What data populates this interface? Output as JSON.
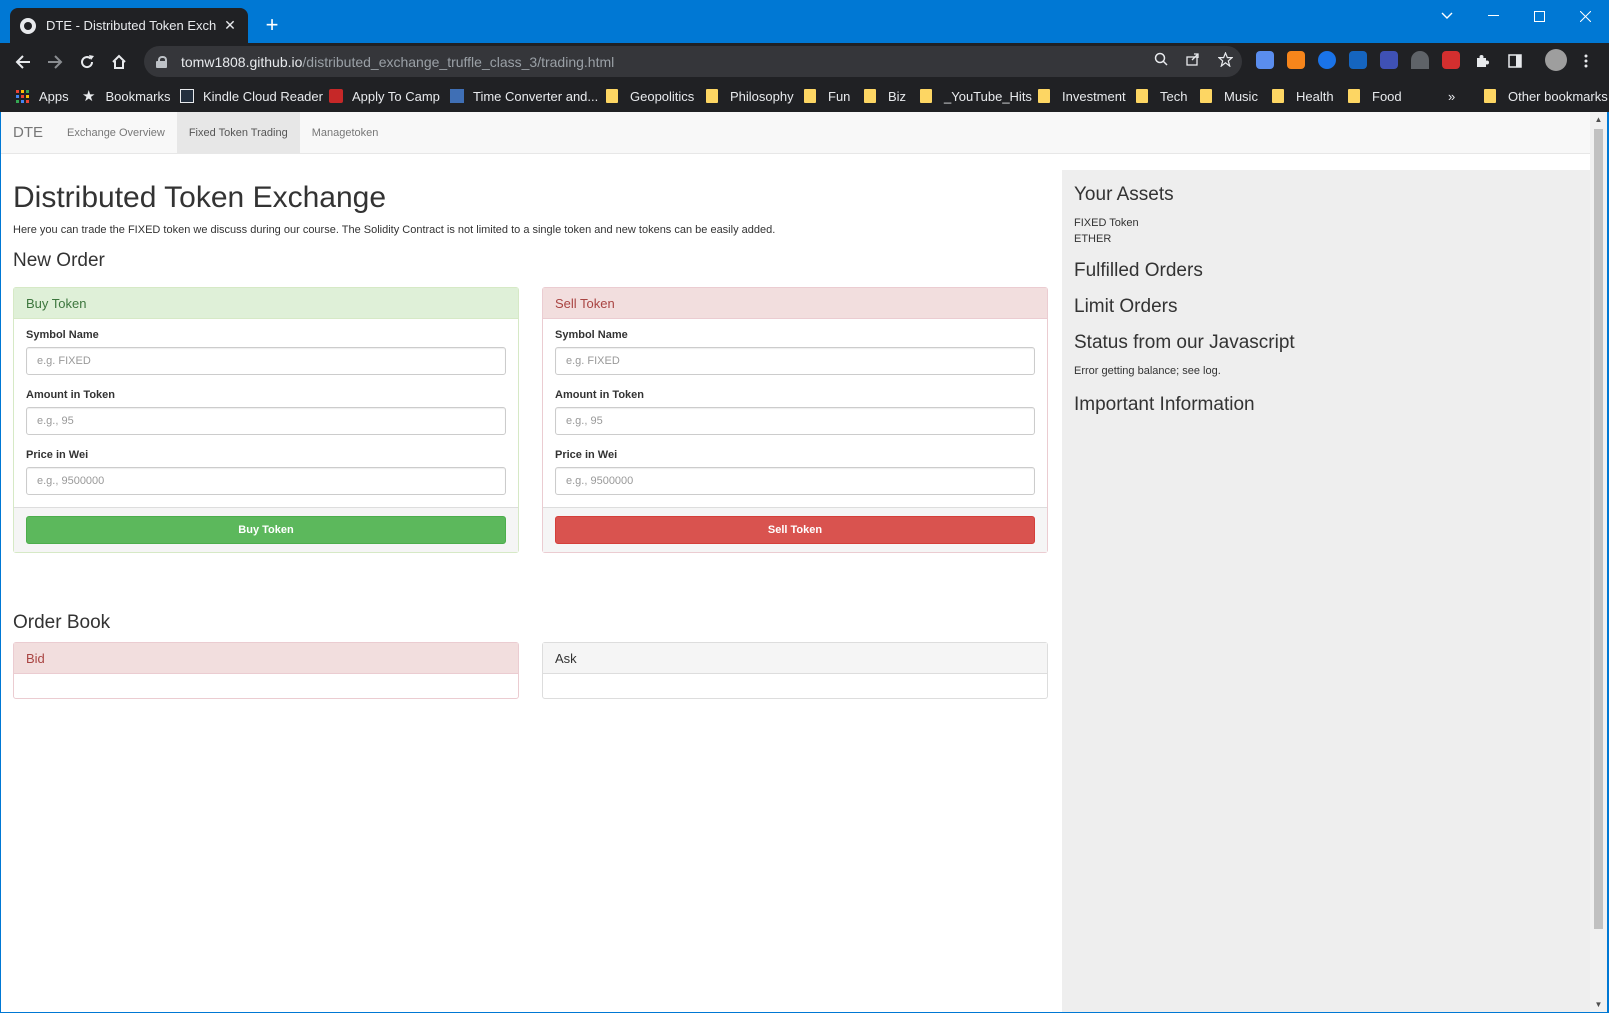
{
  "browser": {
    "tab_title": "DTE - Distributed Token Exchange",
    "tab_close": "✕",
    "new_tab": "+",
    "url_host": "tomw1808.github.io",
    "url_path": "/distributed_exchange_truffle_class_3/trading.html",
    "bookmarks": [
      {
        "label": "Apps",
        "icon": "apps-icon"
      },
      {
        "label": "Bookmarks",
        "icon": "star-icon"
      },
      {
        "label": "Kindle Cloud Reader",
        "icon": "kindle-icon"
      },
      {
        "label": "Apply To Camp",
        "icon": "camp-icon"
      },
      {
        "label": "Time Converter and...",
        "icon": "clock-icon"
      },
      {
        "label": "Geopolitics",
        "icon": "folder-icon"
      },
      {
        "label": "Philosophy",
        "icon": "folder-icon"
      },
      {
        "label": "Fun",
        "icon": "folder-icon"
      },
      {
        "label": "Biz",
        "icon": "folder-icon"
      },
      {
        "label": "_YouTube_Hits",
        "icon": "folder-icon"
      },
      {
        "label": "Investment",
        "icon": "folder-icon"
      },
      {
        "label": "Tech",
        "icon": "folder-icon"
      },
      {
        "label": "Music",
        "icon": "folder-icon"
      },
      {
        "label": "Health",
        "icon": "folder-icon"
      },
      {
        "label": "Food",
        "icon": "folder-icon"
      }
    ],
    "more_bookmarks": "»",
    "other_bookmarks": "Other bookmarks"
  },
  "site": {
    "brand": "DTE",
    "nav": [
      "Exchange Overview",
      "Fixed Token Trading",
      "Managetoken"
    ],
    "active_nav": "Fixed Token Trading"
  },
  "main": {
    "title": "Distributed Token Exchange",
    "intro": "Here you can trade the FIXED token we discuss during our course. The Solidity Contract is not limited to a single token and new tokens can be easily added.",
    "new_order_heading": "New Order",
    "buy": {
      "heading": "Buy Token",
      "symbol_label": "Symbol Name",
      "symbol_placeholder": "e.g. FIXED",
      "amount_label": "Amount in Token",
      "amount_placeholder": "e.g., 95",
      "price_label": "Price in Wei",
      "price_placeholder": "e.g., 9500000",
      "button": "Buy Token"
    },
    "sell": {
      "heading": "Sell Token",
      "symbol_label": "Symbol Name",
      "symbol_placeholder": "e.g. FIXED",
      "amount_label": "Amount in Token",
      "amount_placeholder": "e.g., 95",
      "price_label": "Price in Wei",
      "price_placeholder": "e.g., 9500000",
      "button": "Sell Token"
    },
    "order_book_heading": "Order Book",
    "bid_heading": "Bid",
    "ask_heading": "Ask"
  },
  "sidebar": {
    "assets_heading": "Your Assets",
    "assets": [
      "FIXED Token",
      "ETHER"
    ],
    "fulfilled_heading": "Fulfilled Orders",
    "limit_heading": "Limit Orders",
    "status_heading": "Status from our Javascript",
    "status_text": "Error getting balance; see log.",
    "info_heading": "Important Information"
  },
  "colors": {
    "chrome_blue": "#0078d4",
    "success_bg": "#dff0d8",
    "success_text": "#3c763d",
    "danger_bg": "#f2dede",
    "danger_text": "#a94442",
    "btn_success": "#5cb85c",
    "btn_danger": "#d9534f"
  }
}
